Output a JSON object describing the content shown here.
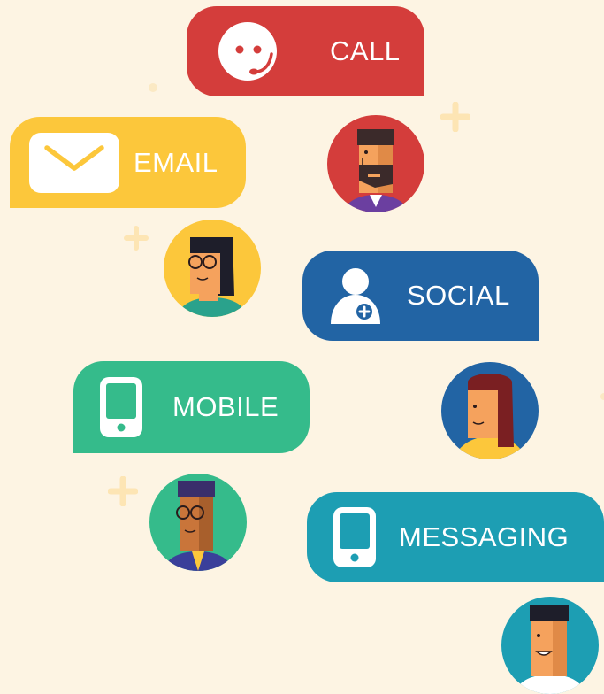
{
  "channels": {
    "call": {
      "label": "CALL",
      "icon": "headset-icon",
      "color": "#d43d3b"
    },
    "email": {
      "label": "EMAIL",
      "icon": "envelope-icon",
      "color": "#fcc73b"
    },
    "social": {
      "label": "SOCIAL",
      "icon": "add-person-icon",
      "color": "#2264a4"
    },
    "mobile": {
      "label": "MOBILE",
      "icon": "phone-icon",
      "color": "#35bb8b"
    },
    "messaging": {
      "label": "MESSAGING",
      "icon": "phone-icon",
      "color": "#1d9eb3"
    }
  },
  "avatars": [
    {
      "icon": "bearded-man-avatar",
      "background": "#d43d3b"
    },
    {
      "icon": "woman-with-glasses-avatar",
      "background": "#fcc73b"
    },
    {
      "icon": "woman-long-hair-avatar",
      "background": "#2264a4"
    },
    {
      "icon": "man-with-glasses-avatar",
      "background": "#35bb8b"
    },
    {
      "icon": "smiling-man-avatar",
      "background": "#1d9eb3"
    }
  ],
  "background_color": "#fdf4e3"
}
